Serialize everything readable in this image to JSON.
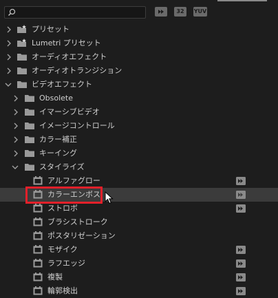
{
  "search": {
    "value": "",
    "placeholder": ""
  },
  "toolbar": {
    "accelerated_label": "",
    "bit32_label": "32",
    "yuv_label": "YUV"
  },
  "tree": [
    {
      "label": "プリセット",
      "icon": "preset-folder-icon",
      "expanded": false
    },
    {
      "label": "Lumetri プリセット",
      "icon": "preset-folder-icon",
      "expanded": false
    },
    {
      "label": "オーディオエフェクト",
      "icon": "folder-icon",
      "expanded": false
    },
    {
      "label": "オーディオトランジション",
      "icon": "folder-icon",
      "expanded": false
    },
    {
      "label": "ビデオエフェクト",
      "icon": "folder-icon",
      "expanded": true
    },
    {
      "label": "Obsolete",
      "icon": "folder-icon",
      "expanded": false
    },
    {
      "label": "イマーシブビデオ",
      "icon": "folder-icon",
      "expanded": false
    },
    {
      "label": "イメージコントロール",
      "icon": "folder-icon",
      "expanded": false
    },
    {
      "label": "カラー補正",
      "icon": "folder-icon",
      "expanded": false
    },
    {
      "label": "キーイング",
      "icon": "folder-icon",
      "expanded": false
    },
    {
      "label": "スタイライズ",
      "icon": "folder-icon",
      "expanded": true
    },
    {
      "label": "アルファグロー",
      "icon": "effect-icon",
      "accelerated": true
    },
    {
      "label": "カラーエンボス",
      "icon": "effect-icon",
      "accelerated": true,
      "selected": true
    },
    {
      "label": "ストロボ",
      "icon": "effect-icon",
      "accelerated": true
    },
    {
      "label": "ブラシストローク",
      "icon": "effect-icon",
      "accelerated": false
    },
    {
      "label": "ポスタリゼーション",
      "icon": "effect-icon",
      "accelerated": false
    },
    {
      "label": "モザイク",
      "icon": "effect-icon",
      "accelerated": true
    },
    {
      "label": "ラフエッジ",
      "icon": "effect-icon",
      "accelerated": true
    },
    {
      "label": "複製",
      "icon": "effect-icon",
      "accelerated": true
    },
    {
      "label": "輪郭検出",
      "icon": "effect-icon",
      "accelerated": true
    }
  ],
  "colors": {
    "background": "#1d1d1d",
    "selection": "#3b3b3b",
    "highlight_box": "#e4202a",
    "icon_gray": "#8a8a8a"
  }
}
